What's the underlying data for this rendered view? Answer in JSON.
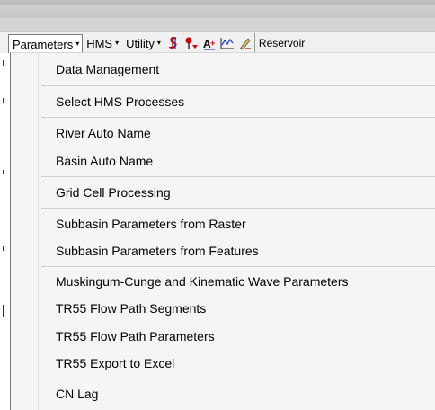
{
  "toolbar": {
    "menus": [
      {
        "label": "Parameters"
      },
      {
        "label": "HMS"
      },
      {
        "label": "Utility"
      }
    ],
    "caret": "▾",
    "reservoir_label": "Reservoir"
  },
  "dropdown": {
    "items": [
      {
        "label": "Data Management"
      },
      {
        "label": "Select HMS Processes"
      },
      {
        "label": "River Auto Name"
      },
      {
        "label": "Basin Auto Name"
      },
      {
        "label": "Grid Cell Processing"
      },
      {
        "label": "Subbasin Parameters from Raster"
      },
      {
        "label": "Subbasin Parameters from Features"
      },
      {
        "label": "Muskingum-Cunge and Kinematic Wave Parameters"
      },
      {
        "label": "TR55 Flow Path Segments"
      },
      {
        "label": "TR55 Flow Path Parameters"
      },
      {
        "label": "TR55 Export to Excel"
      },
      {
        "label": "CN Lag"
      }
    ]
  },
  "icons": [
    "dollar-like-tool-icon",
    "pin-tool-icon",
    "text-label-tool-icon",
    "graph-tool-icon",
    "pencil-edit-icon"
  ],
  "colors": {
    "menu_bg": "#f5f5f5",
    "toolbar_bg": "#f0f0f0",
    "separator": "#cfcfcf"
  }
}
